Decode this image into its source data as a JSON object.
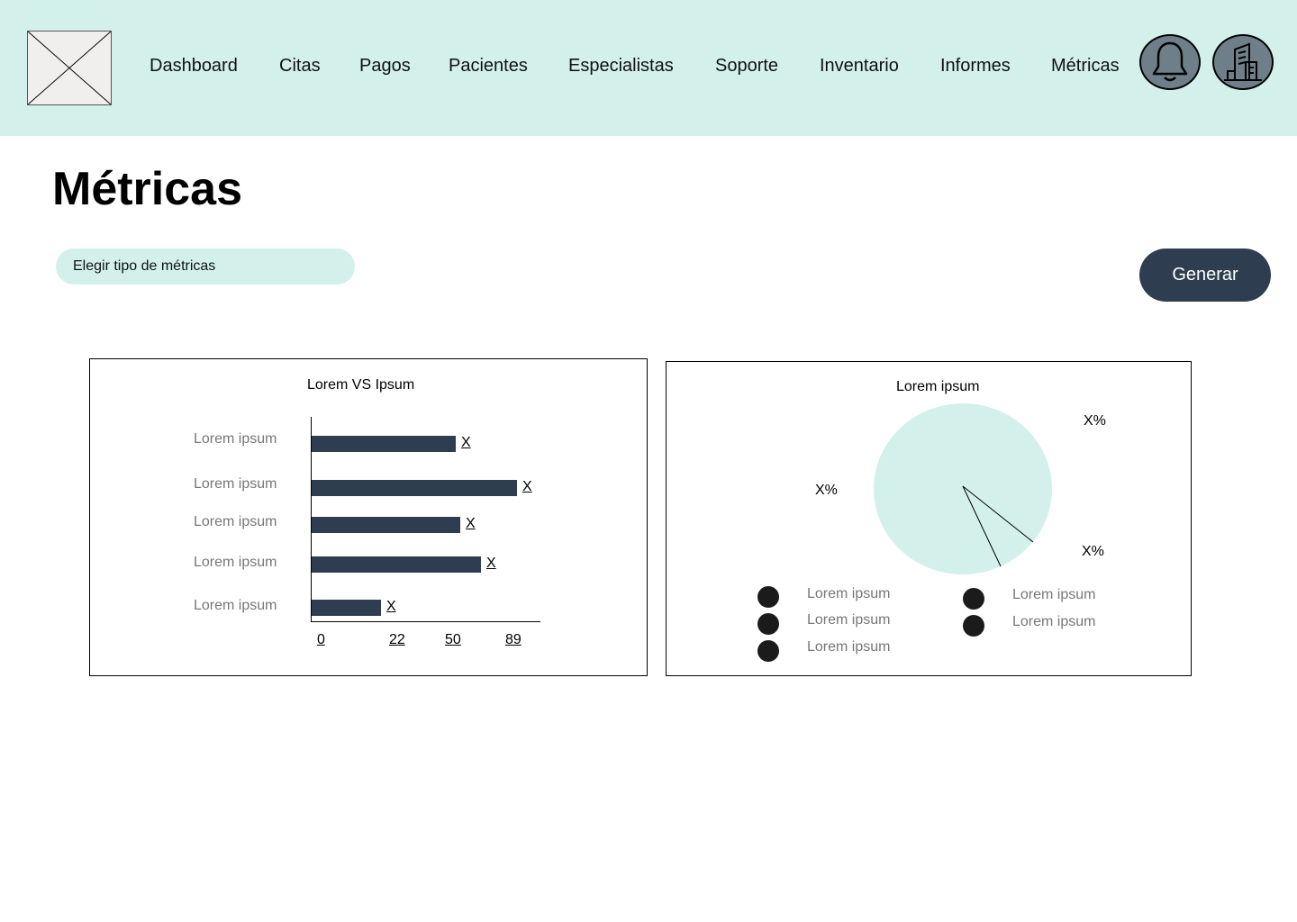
{
  "nav": {
    "items": [
      {
        "label": "Dashboard"
      },
      {
        "label": "Citas"
      },
      {
        "label": "Pagos"
      },
      {
        "label": "Pacientes"
      },
      {
        "label": "Especialistas"
      },
      {
        "label": "Soporte"
      },
      {
        "label": "Inventario"
      },
      {
        "label": "Informes"
      },
      {
        "label": "Métricas"
      }
    ],
    "icons": {
      "notifications": "bell-icon",
      "organization": "building-icon"
    }
  },
  "page": {
    "title": "Métricas"
  },
  "controls": {
    "metric_type_placeholder": "Elegir tipo de métricas",
    "generate_label": "Generar"
  },
  "colors": {
    "accent": "#d3f1ea",
    "primary": "#2e3e50",
    "bar": "#2e3e50",
    "icon_button": "#6e7f8a"
  },
  "chart_data": [
    {
      "type": "bar",
      "orientation": "horizontal",
      "title": "Lorem VS Ipsum",
      "categories": [
        "Lorem ipsum",
        "Lorem ipsum",
        "Lorem ipsum",
        "Lorem ipsum",
        "Lorem ipsum"
      ],
      "values": [
        56,
        80,
        58,
        66,
        27
      ],
      "value_labels": [
        "X",
        "X",
        "X",
        "X",
        "X"
      ],
      "x_ticks": [
        "0",
        "22",
        "50",
        "89"
      ],
      "xlim": [
        0,
        89
      ]
    },
    {
      "type": "pie",
      "title": "Lorem ipsum",
      "slice_labels": [
        "X%",
        "X%",
        "X%"
      ],
      "legend": [
        "Lorem ipsum",
        "Lorem ipsum",
        "Lorem ipsum",
        "Lorem ipsum",
        "Lorem ipsum"
      ]
    }
  ]
}
